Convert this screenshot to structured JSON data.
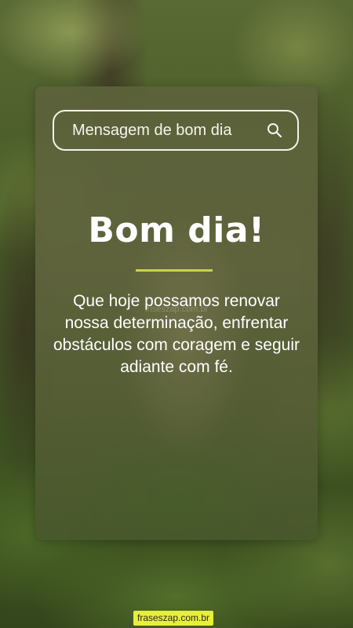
{
  "search": {
    "text": "Mensagem de bom dia",
    "icon": "search-icon"
  },
  "headline": "Bom dia!",
  "message": "Que hoje possamos renovar nossa determinação, enfrentar obstáculos com coragem e seguir adiante com fé.",
  "watermark": "friseszap.com.br",
  "footer": {
    "site": "fraseszap.com.br"
  },
  "colors": {
    "accent": "#c7d34a",
    "badge": "#e7ee3c",
    "text": "#ffffff"
  }
}
